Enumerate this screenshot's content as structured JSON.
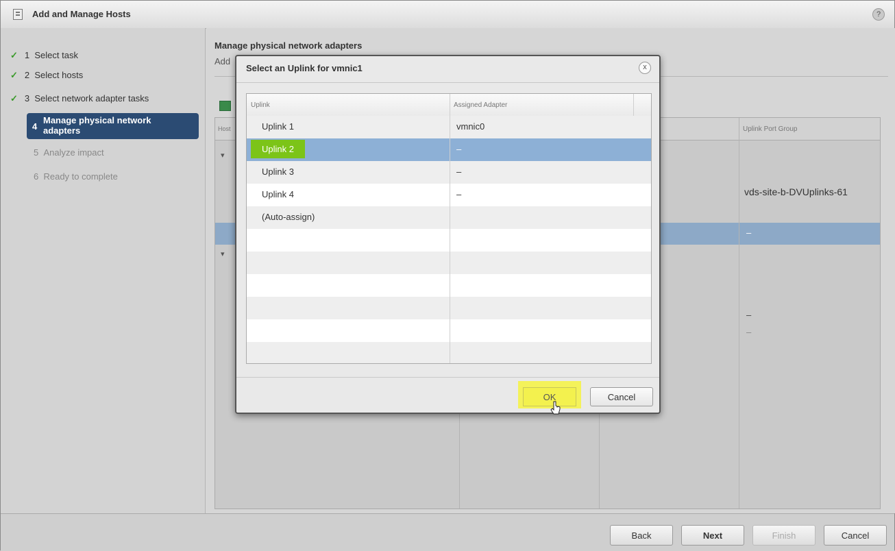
{
  "window": {
    "title": "Add and Manage Hosts",
    "help_label": "?"
  },
  "steps": [
    {
      "num": "1",
      "label": "Select task",
      "done": true
    },
    {
      "num": "2",
      "label": "Select hosts",
      "done": true
    },
    {
      "num": "3",
      "label": "Select network adapter tasks",
      "done": true
    },
    {
      "num": "4",
      "label": "Manage physical network adapters",
      "current": true
    },
    {
      "num": "5",
      "label": "Analyze impact"
    },
    {
      "num": "6",
      "label": "Ready to complete"
    }
  ],
  "main": {
    "heading": "Manage physical network adapters",
    "subheading": "Add",
    "table": {
      "host_header": "Host",
      "uplink_port_group_header": "Uplink Port Group",
      "port_group_value": "vds-site-b-DVUplinks-61",
      "dash": "–"
    }
  },
  "dialog": {
    "title": "Select an Uplink for vmnic1",
    "close_label": "x",
    "columns": [
      "Uplink",
      "Assigned Adapter"
    ],
    "rows": [
      {
        "uplink": "Uplink 1",
        "adapter": "vmnic0"
      },
      {
        "uplink": "Uplink 2",
        "adapter": "–",
        "selected": true
      },
      {
        "uplink": "Uplink 3",
        "adapter": "–"
      },
      {
        "uplink": "Uplink 4",
        "adapter": "–"
      },
      {
        "uplink": "(Auto-assign)",
        "adapter": ""
      }
    ],
    "ok_label": "OK",
    "cancel_label": "Cancel"
  },
  "footer": {
    "back_label": "Back",
    "next_label": "Next",
    "finish_label": "Finish",
    "cancel_label": "Cancel"
  },
  "colors": {
    "current_step_bg": "#2b4b73",
    "selected_row": "#8db0d6",
    "highlight_green": "#7cc418",
    "highlight_yellow": "#f3f14e"
  }
}
